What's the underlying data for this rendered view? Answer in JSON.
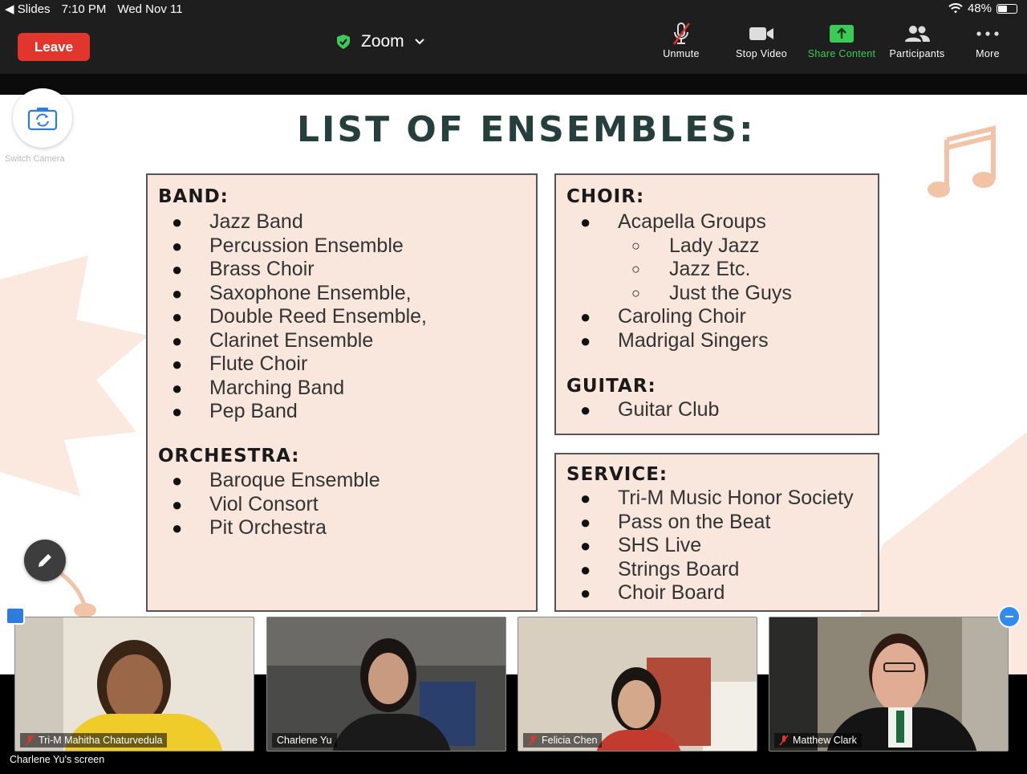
{
  "status_bar": {
    "back_app": "Slides",
    "time": "7:10 PM",
    "date": "Wed Nov 11",
    "battery": "48%"
  },
  "toolbar": {
    "leave_label": "Leave",
    "meeting_title": "Zoom",
    "unmute_label": "Unmute",
    "stop_video_label": "Stop Video",
    "share_label": "Share Content",
    "participants_label": "Participants",
    "more_label": "More"
  },
  "colors": {
    "leave_red": "#e0362e",
    "share_green": "#3ccb58",
    "slide_box": "#f9e6dc",
    "title_teal": "#263f3c",
    "accent_peach": "#f3c3a8"
  },
  "switch_camera_label": "Switch Camera",
  "slide": {
    "title": "LIST OF ENSEMBLES:",
    "band": {
      "heading": "BAND:",
      "items": [
        "Jazz Band",
        "Percussion Ensemble",
        "Brass Choir",
        "Saxophone Ensemble,",
        "Double Reed Ensemble,",
        "Clarinet Ensemble",
        "Flute Choir",
        "Marching Band",
        "Pep Band"
      ]
    },
    "orchestra": {
      "heading": "ORCHESTRA:",
      "items": [
        "Baroque Ensemble",
        "Viol Consort",
        "Pit Orchestra"
      ]
    },
    "choir": {
      "heading": "CHOIR:",
      "item1": "Acapella Groups",
      "subitems": [
        "Lady Jazz",
        "Jazz Etc.",
        "Just the Guys"
      ],
      "item2": "Caroling Choir",
      "item3": "Madrigal Singers"
    },
    "guitar": {
      "heading": "GUITAR:",
      "items": [
        "Guitar Club"
      ]
    },
    "service": {
      "heading": "SERVICE:",
      "items": [
        "Tri-M Music Honor Society",
        "Pass on the Beat",
        "SHS Live",
        "Strings Board",
        "Choir Board"
      ]
    }
  },
  "participants": [
    {
      "name": "Tri-M Mahitha Chaturvedula",
      "muted": true
    },
    {
      "name": "Charlene Yu",
      "muted": false
    },
    {
      "name": "Felicia Chen",
      "muted": true
    },
    {
      "name": "Matthew Clark",
      "muted": true
    }
  ],
  "screen_label": "Charlene Yu's screen"
}
